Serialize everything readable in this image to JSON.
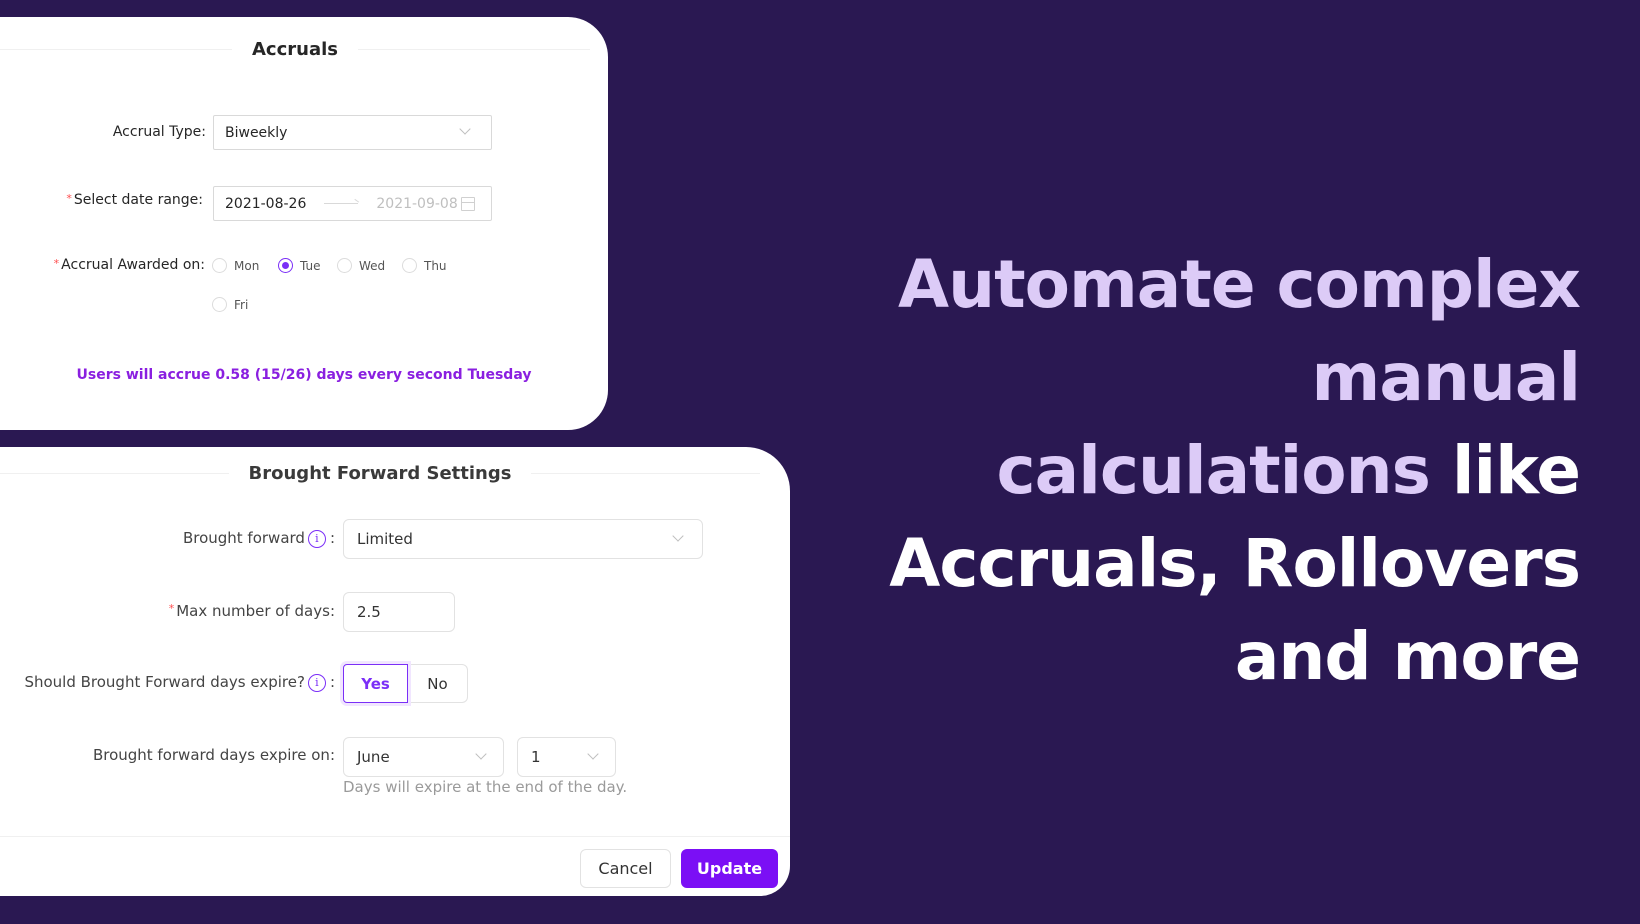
{
  "colors": {
    "background": "#2a1852",
    "accent": "#7b2ff7",
    "headline_highlight": "#dccbf7",
    "headline_white": "#ffffff",
    "accrue_message": "#8a1fe0"
  },
  "accruals": {
    "title": "Accruals",
    "accrual_type": {
      "label": "Accrual Type:",
      "value": "Biweekly",
      "icon": "chevron-down-icon"
    },
    "date_range": {
      "required": true,
      "label": "Select date range:",
      "start": "2021-08-26",
      "end": "2021-09-08",
      "icon": "calendar-icon"
    },
    "awarded_on": {
      "required": true,
      "label": "Accrual Awarded on:",
      "options": [
        {
          "label": "Mon",
          "checked": false
        },
        {
          "label": "Tue",
          "checked": true
        },
        {
          "label": "Wed",
          "checked": false
        },
        {
          "label": "Thu",
          "checked": false
        },
        {
          "label": "Fri",
          "checked": false
        }
      ]
    },
    "message": "Users will accrue 0.58 (15/26) days every second Tuesday"
  },
  "brought_forward": {
    "title": "Brought Forward Settings",
    "brought_forward": {
      "label": "Brought forward",
      "value": "Limited",
      "info_icon": "info-icon"
    },
    "max_days": {
      "required": true,
      "label": "Max number of days",
      "value": "2.5"
    },
    "should_expire": {
      "label": "Should Brought Forward days expire?",
      "options": [
        "Yes",
        "No"
      ],
      "selected": "Yes"
    },
    "expire_on": {
      "label": "Brought forward days expire on",
      "month": "June",
      "day": "1",
      "helper": "Days will expire at the end of the day."
    },
    "colon": ":",
    "cancel_label": "Cancel",
    "update_label": "Update"
  },
  "headline": {
    "lines": [
      [
        {
          "text": "Automate complex",
          "style": "highlight"
        }
      ],
      [
        {
          "text": "manual",
          "style": "highlight"
        }
      ],
      [
        {
          "text": "calculations",
          "style": "highlight"
        },
        {
          "text": " like",
          "style": "white"
        }
      ],
      [
        {
          "text": "Accruals, Rollovers",
          "style": "white"
        }
      ],
      [
        {
          "text": "and more",
          "style": "white"
        }
      ]
    ]
  }
}
